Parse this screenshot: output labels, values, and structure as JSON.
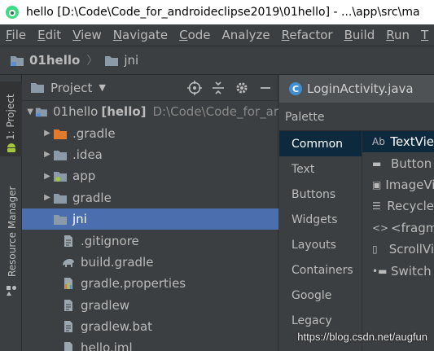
{
  "window": {
    "title": "hello [D:\\Code\\Code_for_androideclipse2019\\01hello] - ...\\app\\src\\ma"
  },
  "menu": {
    "items": [
      {
        "label": "File",
        "mn": "F",
        "rest": "ile"
      },
      {
        "label": "Edit",
        "mn": "E",
        "rest": "dit"
      },
      {
        "label": "View",
        "mn": "V",
        "rest": "iew"
      },
      {
        "label": "Navigate",
        "mn": "N",
        "rest": "avigate"
      },
      {
        "label": "Code",
        "mn": "C",
        "rest": "ode"
      },
      {
        "label": "Analyze",
        "mn": "",
        "rest": "Analyze"
      },
      {
        "label": "Refactor",
        "mn": "R",
        "rest": "efactor"
      },
      {
        "label": "Build",
        "mn": "B",
        "rest": "uild"
      },
      {
        "label": "Run",
        "mn": "R",
        "rest": "un"
      },
      {
        "label": "T",
        "mn": "T",
        "rest": ""
      }
    ]
  },
  "breadcrumb": {
    "project": "01hello",
    "folder": "jni"
  },
  "toolstrip": {
    "project_tab": "1: Project",
    "resource_tab": "Resource Manager"
  },
  "project_panel": {
    "title": "Project",
    "tree": [
      {
        "label": "01hello",
        "bold": "[hello]",
        "path": "D:\\Code\\Code_for_ar"
      },
      {
        "label": ".gradle"
      },
      {
        "label": ".idea"
      },
      {
        "label": "app"
      },
      {
        "label": "gradle"
      },
      {
        "label": "jni"
      },
      {
        "label": ".gitignore"
      },
      {
        "label": "build.gradle"
      },
      {
        "label": "gradle.properties"
      },
      {
        "label": "gradlew"
      },
      {
        "label": "gradlew.bat"
      },
      {
        "label": "hello.iml"
      }
    ]
  },
  "editor": {
    "tab_label": "LoginActivity.java"
  },
  "palette": {
    "label": "Palette",
    "categories": [
      "Common",
      "Text",
      "Buttons",
      "Widgets",
      "Layouts",
      "Containers",
      "Google",
      "Legacy"
    ],
    "items": [
      {
        "label": "TextVie",
        "icon": "Ab"
      },
      {
        "label": "Button",
        "icon": "▬"
      },
      {
        "label": "ImageVi",
        "icon": "▣"
      },
      {
        "label": "Recycle",
        "icon": "☰"
      },
      {
        "label": "<fragm",
        "icon": "<>"
      },
      {
        "label": "ScrollVi",
        "icon": "▯"
      },
      {
        "label": "Switch",
        "icon": "•▬"
      }
    ]
  },
  "watermark": "https://blog.csdn.net/augfun",
  "colors": {
    "selection": "#4b6eaf",
    "folder": "#8a9aa9",
    "android_green": "#a4c639",
    "orange_folder": "#e07a2c"
  }
}
